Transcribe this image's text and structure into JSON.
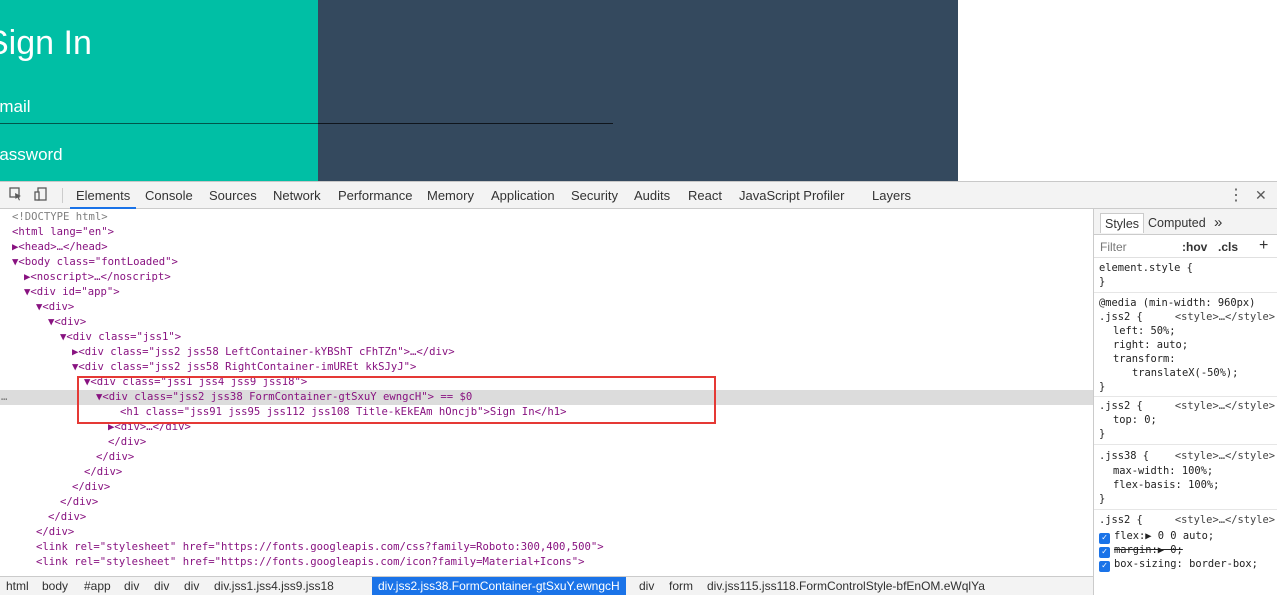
{
  "page": {
    "title": "Sign In",
    "email_label": "Email",
    "password_label": "Password"
  },
  "devtools": {
    "tabs": [
      "Elements",
      "Console",
      "Sources",
      "Network",
      "Performance",
      "Memory",
      "Application",
      "Security",
      "Audits",
      "React",
      "JavaScript Profiler",
      "Layers"
    ],
    "active_tab": "Elements",
    "dom": [
      {
        "t": "<!DOCTYPE html>"
      },
      {
        "t": "<html lang=\"en\">"
      },
      {
        "t": "▶<head>…</head>"
      },
      {
        "t": "▼<body class=\"fontLoaded\">"
      },
      {
        "t": "▶<noscript>…</noscript>"
      },
      {
        "t": "▼<div id=\"app\">"
      },
      {
        "t": "▼<div>"
      },
      {
        "t": "▼<div>"
      },
      {
        "t": "▼<div class=\"jss1\">"
      },
      {
        "t": "▶<div class=\"jss2 jss58 LeftContainer-kYBShT cFhTZn\">…</div>"
      },
      {
        "t": "▼<div class=\"jss2 jss58 RightContainer-imUREt kkSJyJ\">"
      },
      {
        "t": "▼<div class=\"jss1 jss4 jss9 jss18\">"
      },
      {
        "t": "▼<div class=\"jss2 jss38 FormContainer-gtSxuY ewngcH\"> == $0"
      },
      {
        "t": "<h1 class=\"jss91 jss95 jss112 jss108 Title-kEkEAm hOncjb\">Sign In</h1>"
      },
      {
        "t": "▶<div>…</div>"
      },
      {
        "t": "</div>"
      },
      {
        "t": "</div>"
      },
      {
        "t": "</div>"
      },
      {
        "t": "</div>"
      },
      {
        "t": "</div>"
      },
      {
        "t": "</div>"
      },
      {
        "t": "</div>"
      },
      {
        "t": "<link rel=\"stylesheet\" href=\"https://fonts.googleapis.com/css?family=Roboto:300,400,500\">"
      },
      {
        "t": "<link rel=\"stylesheet\" href=\"https://fonts.googleapis.com/icon?family=Material+Icons\">"
      }
    ],
    "breadcrumbs": [
      "html",
      "body",
      "#app",
      "div",
      "div",
      "div",
      "div.jss1.jss4.jss9.jss18",
      "div.jss2.jss38.FormContainer-gtSxuY.ewngcH",
      "div",
      "form",
      "div.jss115.jss118.FormControlStyle-bfEnOM.eWqlYa"
    ],
    "active_breadcrumb": "div.jss2.jss38.FormContainer-gtSxuY.ewngcH",
    "styles_tabs": [
      "Styles",
      "Computed"
    ],
    "filter_placeholder": "Filter",
    "hov": ":hov",
    "cls": ".cls",
    "element_style": "element.style {",
    "media": "@media (min-width: 960px)",
    "rule1_sel": ".jss2 {",
    "rule1_src": "<style>…</style>",
    "rule1_p1": "left: 50%;",
    "rule1_p2": "right: auto;",
    "rule1_p3": "transform:",
    "rule1_p3b": "translateX(-50%);",
    "rule2_sel": ".jss2 {",
    "rule2_p1": "top: 0;",
    "rule3_sel": ".jss38 {",
    "rule3_p1": "max-width: 100%;",
    "rule3_p2": "flex-basis: 100%;",
    "rule4_sel": ".jss2 {",
    "rule4_p1": "flex:▶ 0 0 auto;",
    "rule4_p2": "margin:▶ 0;",
    "rule4_p3": "box-sizing: border-box;",
    "close_brace": "}",
    "eq0": "== $0",
    "dots": "…",
    "tab_more": "»",
    "menu_icon": "⋮",
    "close_icon": "✕",
    "plus_icon": "+"
  }
}
